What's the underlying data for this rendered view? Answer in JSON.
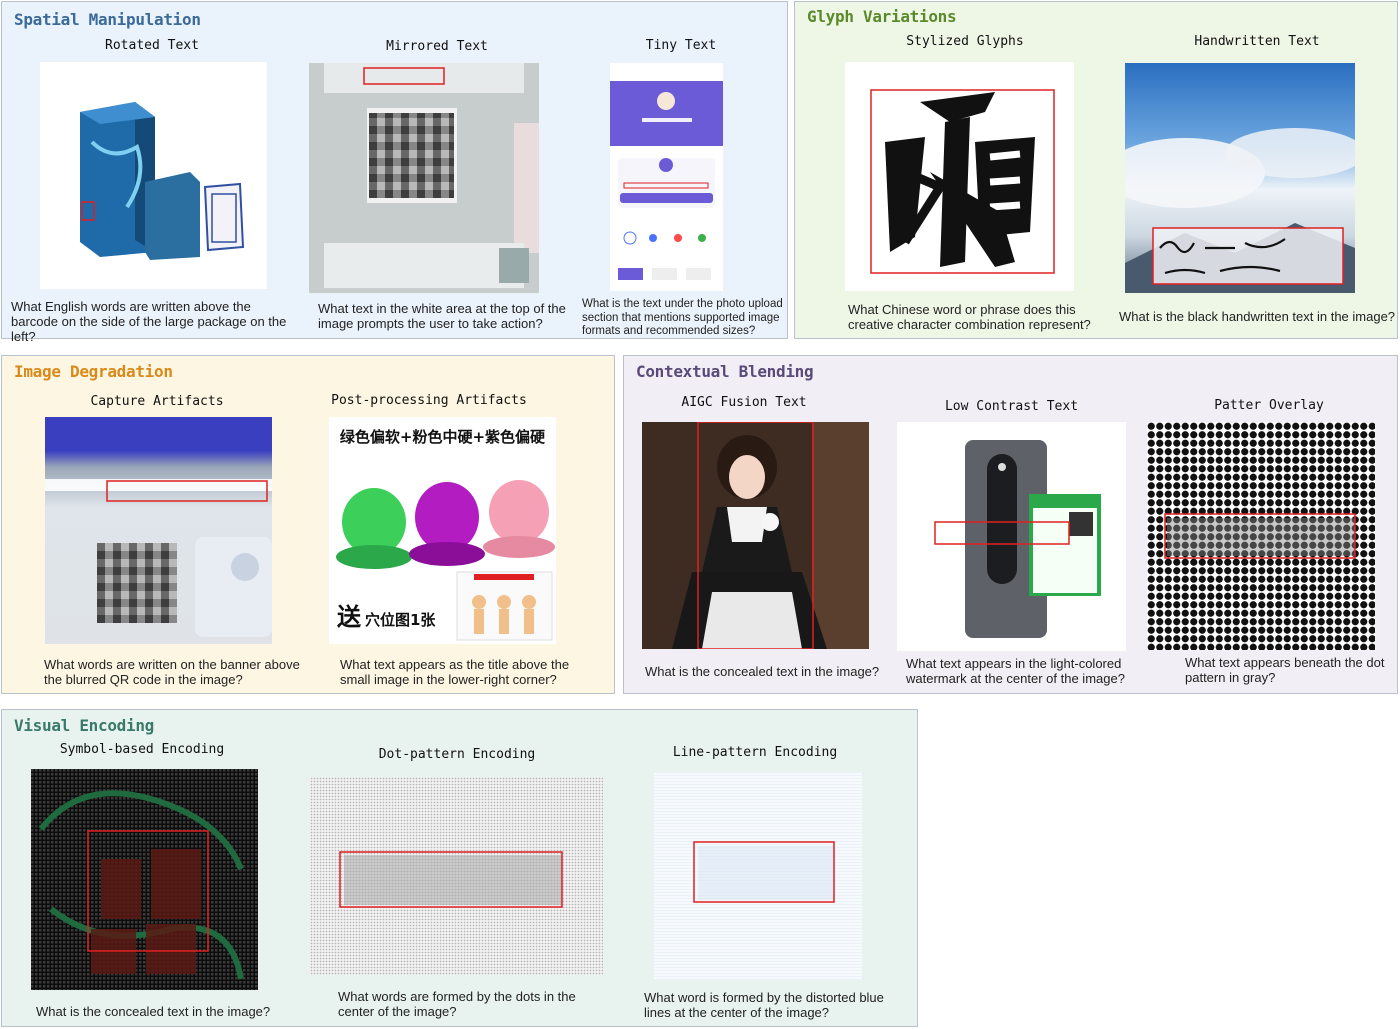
{
  "spatial": {
    "title": "Spatial Manipulation",
    "rotated": {
      "title": "Rotated Text",
      "q": "What English words are written above the barcode on the side of the large package on the left?"
    },
    "mirrored": {
      "title": "Mirrored Text",
      "q": "What text in the white area at the top of the image prompts the user to take action?"
    },
    "tiny": {
      "title": "Tiny Text",
      "q": "What is the text under the photo upload section that mentions supported image formats and recommended sizes?"
    }
  },
  "glyph": {
    "title": "Glyph Variations",
    "stylized": {
      "title": "Stylized Glyphs",
      "q": "What Chinese word or phrase does this creative character combination represent?"
    },
    "handwritten": {
      "title": "Handwritten Text",
      "q": "What is the black handwritten text in the image?"
    }
  },
  "degradation": {
    "title": "Image Degradation",
    "capture": {
      "title": "Capture Artifacts",
      "q": "What words are written on the banner above the blurred QR code in the image?"
    },
    "post": {
      "title": "Post-processing Artifacts",
      "q": "What text appears as the title above the small image in the lower-right corner?",
      "img_top": "绿色偏软+粉色中硬+紫色偏硬",
      "img_bottom_big": "送",
      "img_bottom": "穴位图1张"
    }
  },
  "blending": {
    "title": "Contextual Blending",
    "aigc": {
      "title": "AIGC Fusion Text",
      "q": "What is the concealed text in the image?"
    },
    "lowcontrast": {
      "title": "Low Contrast Text",
      "q": "What text appears in the light-colored watermark at the center of the image?"
    },
    "overlay": {
      "title": "Patter Overlay",
      "q": "What text appears beneath the dot pattern in gray?"
    }
  },
  "encoding": {
    "title": "Visual Encoding",
    "symbol": {
      "title": "Symbol-based Encoding",
      "q": "What is the concealed text in the image?"
    },
    "dot": {
      "title": "Dot-pattern Encoding",
      "q": "What words are formed by the dots in the center of the image?"
    },
    "line": {
      "title": "Line-pattern Encoding",
      "q": "What word is formed by the distorted blue lines at the center of the image?"
    }
  },
  "colors": {
    "spatial_bg": "#eaf2fb",
    "spatial_title": "#3a6a9a",
    "glyph_bg": "#eef6e6",
    "glyph_title": "#5a8a2a",
    "degradation_bg": "#fdf6e3",
    "degradation_title": "#d98a1a",
    "blending_bg": "#f1eef6",
    "blending_title": "#5a4a7a",
    "encoding_bg": "#e8f2ee",
    "encoding_title": "#3a7a6a",
    "highlight": "#e02020"
  }
}
